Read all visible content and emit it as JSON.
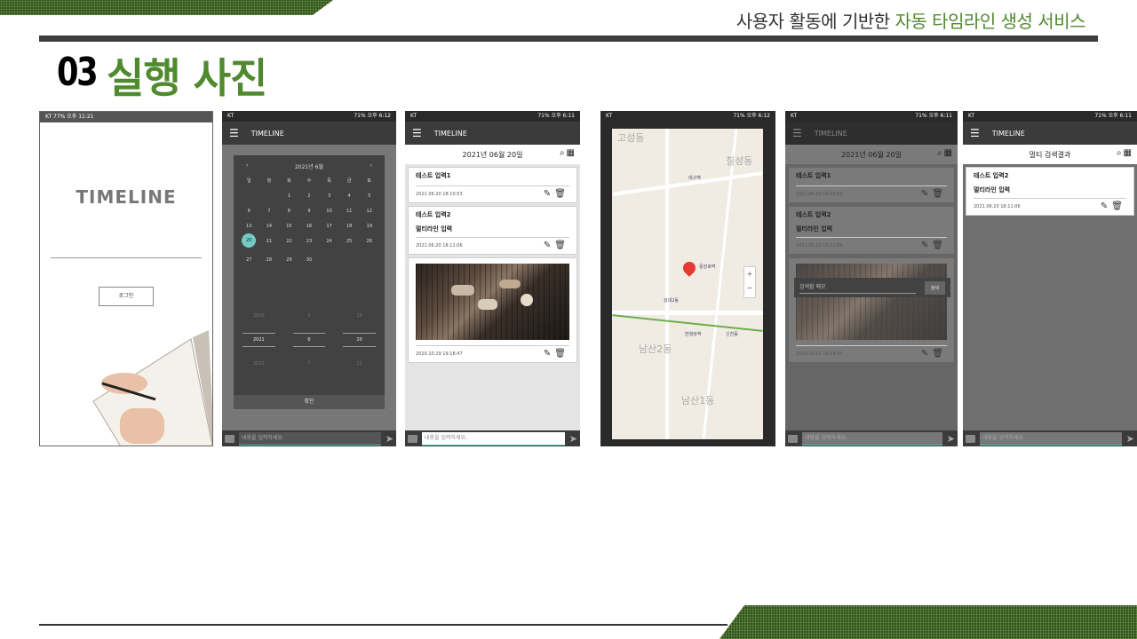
{
  "header": {
    "subtitle_main": "사용자 활동에 기반한 ",
    "subtitle_highlight": "자동 타임라인 생성 서비스",
    "title_number": "03",
    "title_text": "실행 사진"
  },
  "phone1": {
    "status": "KT  77% 오후 11:21",
    "logo": "TIMELINE",
    "login_button": "로그인"
  },
  "common": {
    "status_left": "KT",
    "status_right": "71% 오후 6:12",
    "status_right_b": "71% 오후 6:11",
    "app_title": "TIMELINE",
    "input_placeholder": "내용을 입력하세요.",
    "date": "2021년 06월 20일",
    "multi_result": "멀티 검색결과"
  },
  "calendar": {
    "month": "2021년 6월",
    "weekdays": [
      "일",
      "월",
      "화",
      "수",
      "목",
      "금",
      "토"
    ],
    "days": [
      "",
      "",
      "1",
      "2",
      "3",
      "4",
      "5",
      "6",
      "7",
      "8",
      "9",
      "10",
      "11",
      "12",
      "13",
      "14",
      "15",
      "16",
      "17",
      "18",
      "19",
      "20",
      "21",
      "22",
      "23",
      "24",
      "25",
      "26",
      "27",
      "28",
      "29",
      "30",
      "",
      "",
      ""
    ],
    "selected_day": "20",
    "picker": [
      "2020",
      "5",
      "19",
      "2021",
      "6",
      "20",
      "2022",
      "7",
      "21"
    ],
    "confirm": "확인"
  },
  "entries": [
    {
      "title": "테스트 입력1",
      "body": "",
      "time": "2021.06.20 18:10:53"
    },
    {
      "title": "테스트 입력2",
      "body": "멀티라인 입력",
      "time": "2021.06.20 18:11:06"
    },
    {
      "title": "",
      "body": "",
      "time": "2020.10.29 19:18:47"
    }
  ],
  "map": {
    "labels": [
      "대구역",
      "중앙로역",
      "반월당역",
      "남산2동",
      "대구광역시",
      "남산1동",
      "성내2동",
      "대구은행",
      "신천동"
    ]
  },
  "search": {
    "placeholder": "검색할 메모",
    "button": "검색"
  },
  "multi": {
    "title": "테스트 입력2",
    "body": "멀티라인 입력",
    "time": "2021.06.20 18:11:06"
  },
  "icons": [
    "menu-icon",
    "search-icon",
    "calendar-icon",
    "edit-icon",
    "delete-icon",
    "send-icon",
    "image-icon",
    "map-pin-icon"
  ],
  "colors": {
    "accent_green": "#4f8a2f",
    "teal": "#73cbc4"
  }
}
